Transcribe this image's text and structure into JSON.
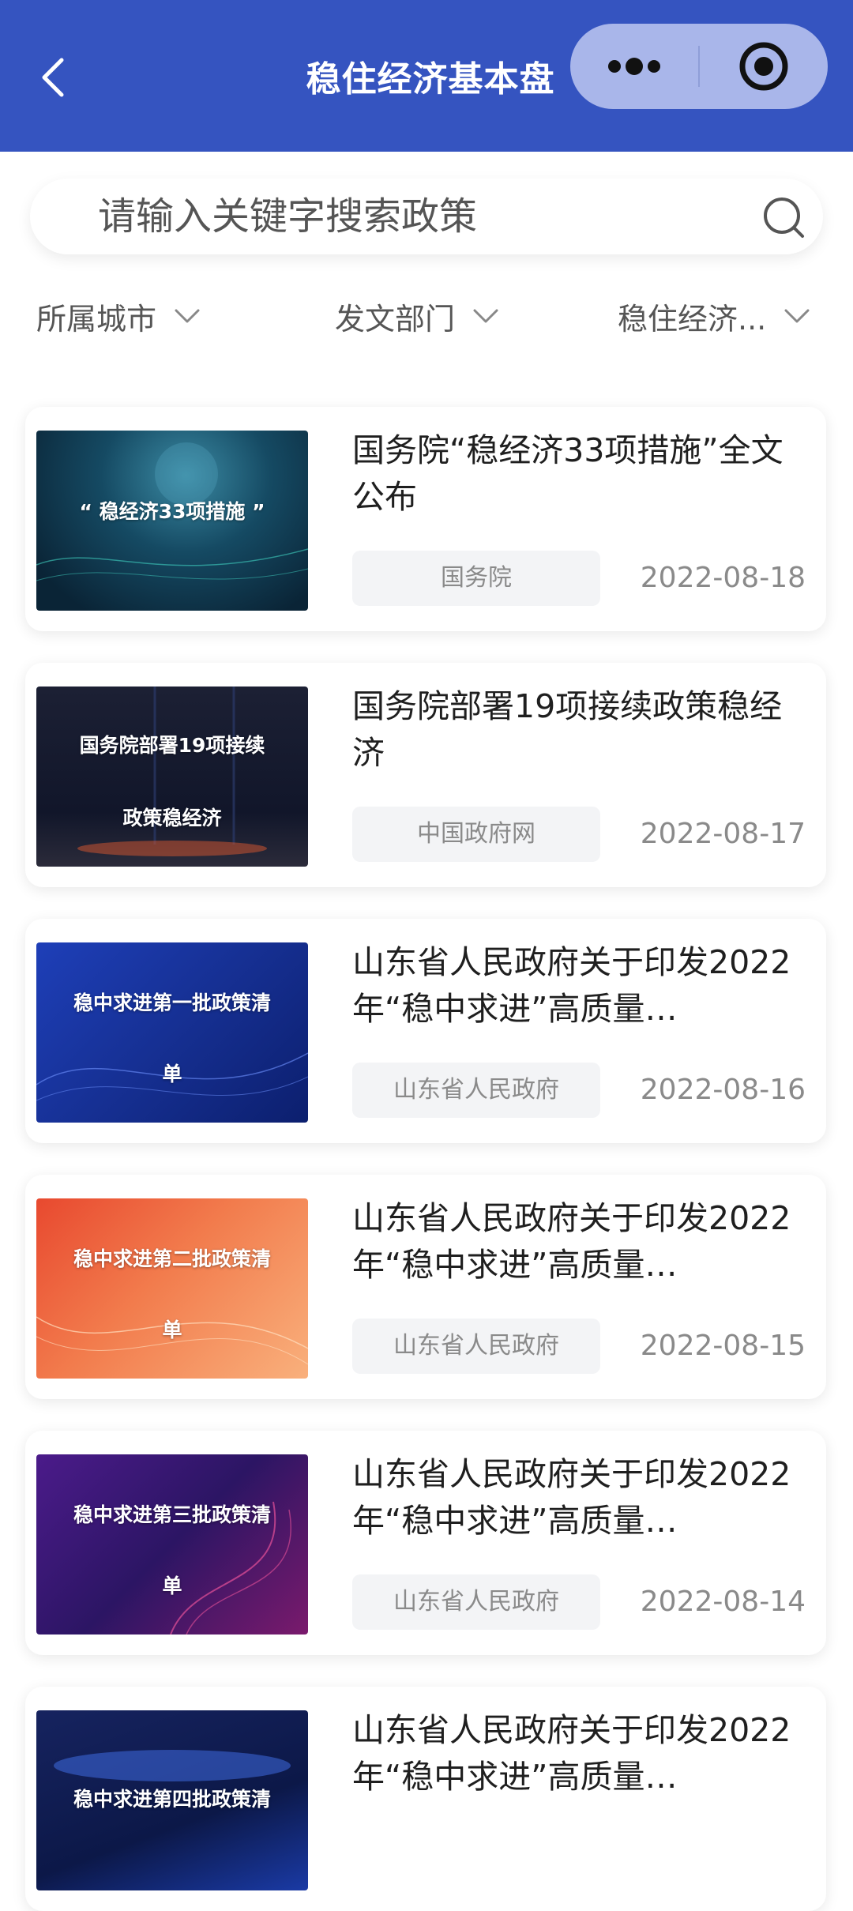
{
  "header": {
    "title": "稳住经济基本盘",
    "back_icon": "chevron-left-icon",
    "more_icon": "more-dots-icon",
    "close_icon": "target-close-icon",
    "bg_color": "#3554c0",
    "capsule_color": "#a9b6ea"
  },
  "search": {
    "placeholder": "请输入关键字搜索政策",
    "icon": "search-icon"
  },
  "filters": [
    {
      "label": "所属城市"
    },
    {
      "label": "发文部门"
    },
    {
      "label": "稳住经济..."
    }
  ],
  "articles": [
    {
      "title": "国务院“稳经济33项措施”全文公布",
      "thumb_caption": "“ 稳经济33项措施 ”",
      "source": "国务院",
      "date": "2022-08-18"
    },
    {
      "title": "国务院部署19项接续政策稳经济",
      "thumb_caption_1": "国务院部署19项接续",
      "thumb_caption_2": "政策稳经济",
      "source": "中国政府网",
      "date": "2022-08-17"
    },
    {
      "title": "山东省人民政府关于印发2022年“稳中求进”高质量…",
      "thumb_caption_1": "稳中求进第一批政策清",
      "thumb_caption_2": "单",
      "source": "山东省人民政府",
      "date": "2022-08-16"
    },
    {
      "title": "山东省人民政府关于印发2022年“稳中求进”高质量…",
      "thumb_caption_1": "稳中求进第二批政策清",
      "thumb_caption_2": "单",
      "source": "山东省人民政府",
      "date": "2022-08-15"
    },
    {
      "title": "山东省人民政府关于印发2022年“稳中求进”高质量…",
      "thumb_caption_1": "稳中求进第三批政策清",
      "thumb_caption_2": "单",
      "source": "山东省人民政府",
      "date": "2022-08-14"
    },
    {
      "title": "山东省人民政府关于印发2022年“稳中求进”高质量…",
      "thumb_caption_1": "稳中求进第四批政策清",
      "source": "",
      "date": ""
    }
  ]
}
